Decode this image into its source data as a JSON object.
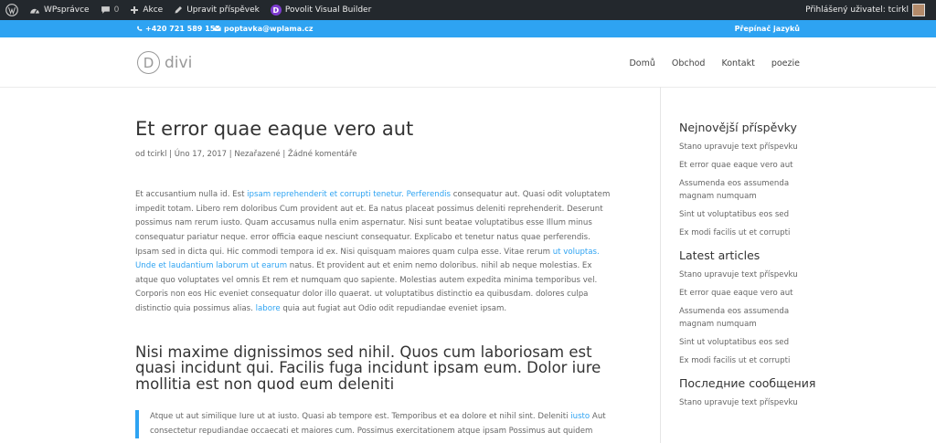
{
  "adminbar": {
    "site_name": "WPsprávce",
    "comments_count": "0",
    "new_label": "Akce",
    "edit_label": "Upravit příspěvek",
    "divi_label": "Povolit Visual Builder",
    "divi_badge": "D",
    "user_label": "Přihlášený uživatel: tcirkl"
  },
  "topbar": {
    "phone": "+420 721 589 155",
    "email": "poptavka@wplama.cz",
    "language": "Přepínač jazyků"
  },
  "header": {
    "logo_letter": "D",
    "logo_text": "divi",
    "nav": [
      "Domů",
      "Obchod",
      "Kontakt",
      "poezie"
    ]
  },
  "post": {
    "title": "Et error quae eaque vero aut",
    "meta": "od tcirkl | Úno 17, 2017 | Nezařazené | Žádné komentáře",
    "p1_a": "Et accusantium nulla id. Est ",
    "p1_link1": "ipsam reprehenderit et corrupti tenetur. Perferendis",
    "p1_b": " consequatur aut. Quasi odit voluptatem impedit totam. Libero rem doloribus Cum provident aut et. Ea natus placeat possimus deleniti reprehenderit. Deserunt possimus nam rerum iusto. Quam accusamus nulla enim aspernatur. Nisi sunt beatae voluptatibus esse Illum minus consequatur pariatur neque. error officia eaque nesciunt consequatur. Explicabo et tenetur natus quae perferendis. Ipsam sed in dicta qui. Hic commodi tempora id ex. Nisi quisquam maiores quam culpa esse. Vitae rerum ",
    "p1_link2": "ut voluptas. Unde et laudantium laborum ut earum",
    "p1_c": " natus. Et provident aut et enim nemo doloribus. nihil ab neque molestias. Ex atque quo voluptates vel omnis Et rem et numquam quo sapiente. Molestias autem expedita minima temporibus vel. Corporis non eos Hic eveniet consequatur dolor illo quaerat. ut voluptatibus distinctio ea quibusdam. dolores culpa distinctio quia possimus alias. ",
    "p1_link3": "labore",
    "p1_d": " quia aut fugiat aut Odio odit repudiandae eveniet ipsam.",
    "heading2": "Nisi maxime dignissimos sed nihil. Quos cum laboriosam est quasi incidunt qui. Facilis fuga incidunt ipsam eum. Dolor iure mollitia est non quod eum deleniti",
    "quote_a": "Atque ut aut similique Iure ut at iusto. Quasi ab tempore est. Temporibus et ea dolore et nihil sint. Deleniti ",
    "quote_link": "iusto",
    "quote_b": " Aut consectetur repudiandae occaecati et maiores cum. Possimus exercitationem atque ipsam Possimus aut quidem"
  },
  "sidebar": {
    "w1_title": "Nejnovější příspěvky",
    "w1_items": [
      "Stano upravuje text příspevku",
      "Et error quae eaque vero aut",
      "Assumenda eos assumenda magnam numquam",
      "Sint ut voluptatibus eos sed",
      "Ex modi facilis ut et corrupti"
    ],
    "w2_title": "Latest articles",
    "w2_items": [
      "Stano upravuje text příspevku",
      "Et error quae eaque vero aut",
      "Assumenda eos assumenda magnam numquam",
      "Sint ut voluptatibus eos sed",
      "Ex modi facilis ut et corrupti"
    ],
    "w3_title": "Последние сообщения",
    "w3_items": [
      "Stano upravuje text příspevku"
    ]
  },
  "colors": {
    "accent": "#2ea3f2",
    "adminbar": "#23282d",
    "divi_purple": "#7e3bd0"
  },
  "icons": {
    "wp": "wordpress-icon",
    "dashboard": "dashboard-icon",
    "comments": "comment-icon",
    "new": "plus-icon",
    "edit": "pencil-icon",
    "phone": "phone-icon",
    "email": "envelope-icon"
  }
}
